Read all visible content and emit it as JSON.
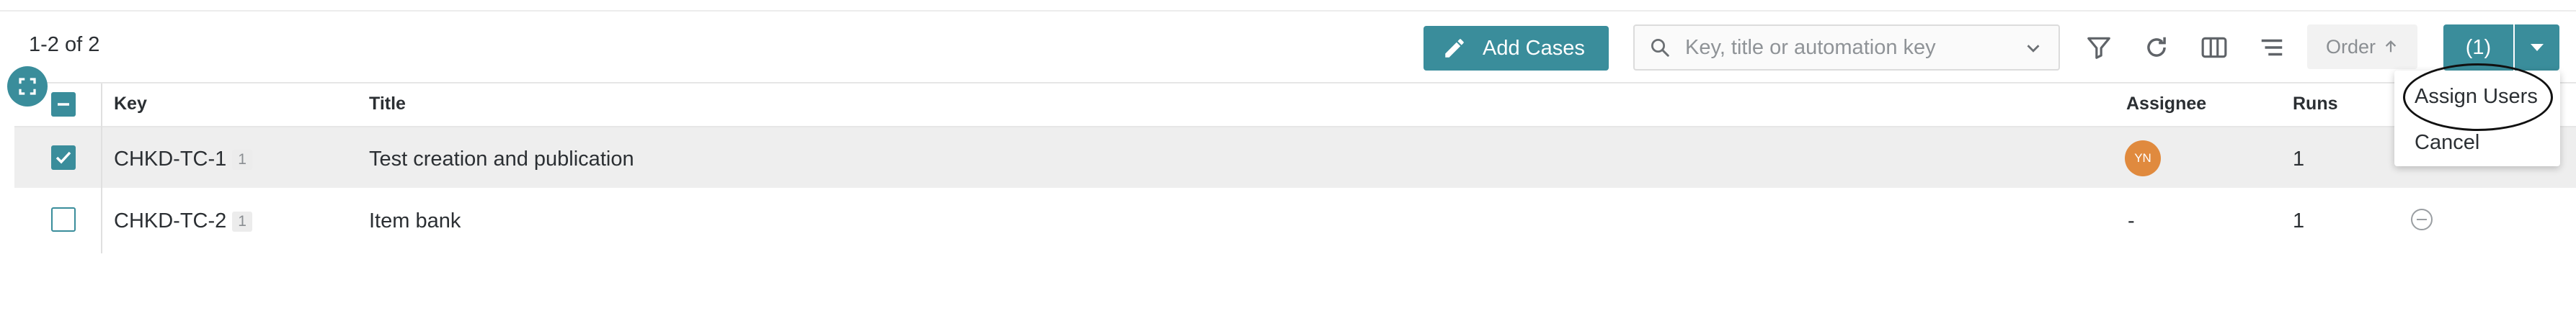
{
  "pagination": {
    "count_label": "1-2 of 2"
  },
  "toolbar": {
    "add_cases_label": "Add Cases",
    "search_placeholder": "Key, title or automation key",
    "order_label": "Order",
    "selection_label": "(1)"
  },
  "dropdown": {
    "items": [
      "Assign Users",
      "Cancel"
    ]
  },
  "table": {
    "columns": [
      "Key",
      "Title",
      "Assignee",
      "Runs"
    ],
    "rows": [
      {
        "key": "CHKD-TC-1",
        "version": "1",
        "title": "Test creation and publication",
        "assignee": "YN",
        "runs": "1",
        "checked": true
      },
      {
        "key": "CHKD-TC-2",
        "version": "1",
        "title": "Item bank",
        "assignee": "-",
        "runs": "1",
        "checked": false
      }
    ]
  },
  "colors": {
    "accent": "#3a8d9b",
    "avatar": "#e08a3e",
    "selected_row": "#eeeeee"
  }
}
